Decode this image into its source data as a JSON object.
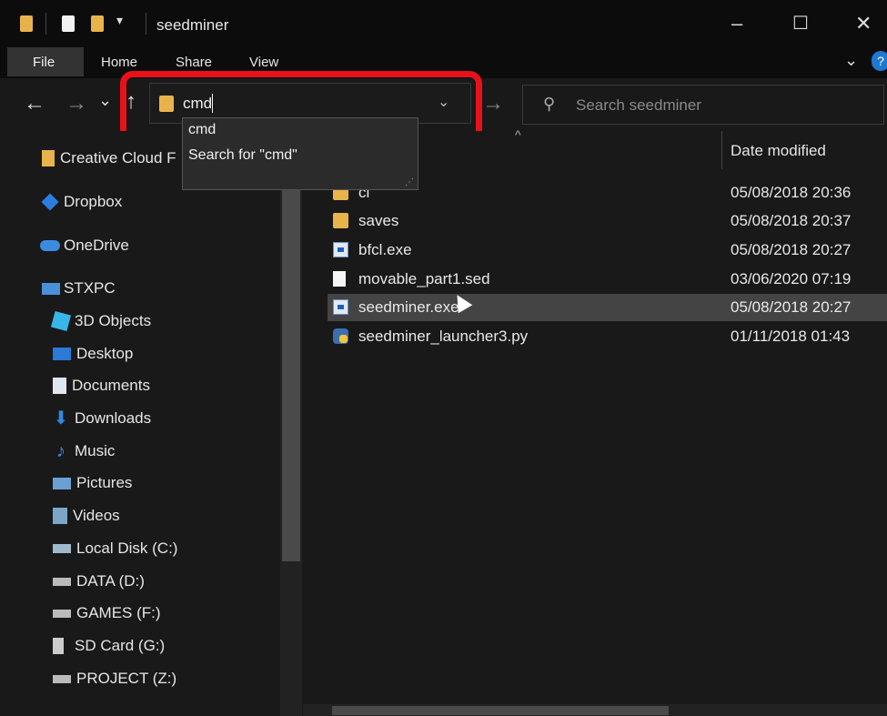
{
  "window": {
    "title": "seedminer"
  },
  "ribbon": {
    "tabs": [
      "File",
      "Home",
      "Share",
      "View"
    ]
  },
  "address": {
    "value": "cmd"
  },
  "search": {
    "placeholder": "Search seedminer"
  },
  "dropdown": {
    "items": [
      "cmd",
      "Search for \"cmd\""
    ]
  },
  "sidebar": {
    "items": [
      "Creative Cloud F",
      "Dropbox",
      "OneDrive",
      "STXPC",
      "3D Objects",
      "Desktop",
      "Documents",
      "Downloads",
      "Music",
      "Pictures",
      "Videos",
      "Local Disk (C:)",
      "DATA (D:)",
      "GAMES (F:)",
      "SD Card (G:)",
      "PROJECT (Z:)"
    ]
  },
  "columns": {
    "date_modified": "Date modified"
  },
  "files": [
    {
      "name": "cl",
      "date": "05/08/2018 20:36",
      "icon": "folder-icon"
    },
    {
      "name": "saves",
      "date": "05/08/2018 20:37",
      "icon": "folder-icon"
    },
    {
      "name": "bfcl.exe",
      "date": "05/08/2018 20:27",
      "icon": "exe-icon"
    },
    {
      "name": "movable_part1.sed",
      "date": "03/06/2020 07:19",
      "icon": "file-icon"
    },
    {
      "name": "seedminer.exe",
      "date": "05/08/2018 20:27",
      "icon": "exe-icon"
    },
    {
      "name": "seedminer_launcher3.py",
      "date": "01/11/2018 01:43",
      "icon": "python-icon"
    }
  ],
  "colors": {
    "highlight": "#e8111a",
    "selection": "#444444",
    "folder": "#e8b34a"
  }
}
